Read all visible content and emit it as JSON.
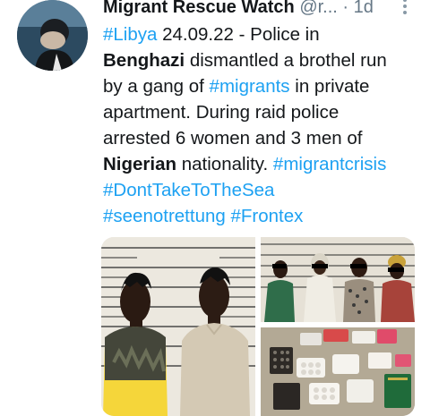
{
  "author": {
    "name": "Migrant Rescue Watch",
    "handle": "@r...",
    "separator": "·",
    "time": "1d"
  },
  "tweet": {
    "hashtag_libya": "#Libya",
    "date_text": "24.09.22 - Police in",
    "city": "Benghazi",
    "text_2": "dismantled a brothel run",
    "text_3": "by a gang of",
    "hashtag_migrants": "#migrants",
    "text_3b": "in private",
    "text_4": "apartment. During raid police",
    "text_5": "arrested 6 women and 3 men of",
    "nationality": "Nigerian",
    "text_6": "nationality.",
    "hashtag_migrantcrisis": "#migrantcrisis",
    "hashtag_donttake": "#DontTakeToTheSea",
    "hashtag_seenot": "#seenotrettung",
    "hashtag_frontex": "#Frontex"
  },
  "icons": {
    "more": "more-vertical-icon"
  },
  "colors": {
    "link": "#1da1f2",
    "text": "#14171a",
    "muted": "#657786"
  }
}
